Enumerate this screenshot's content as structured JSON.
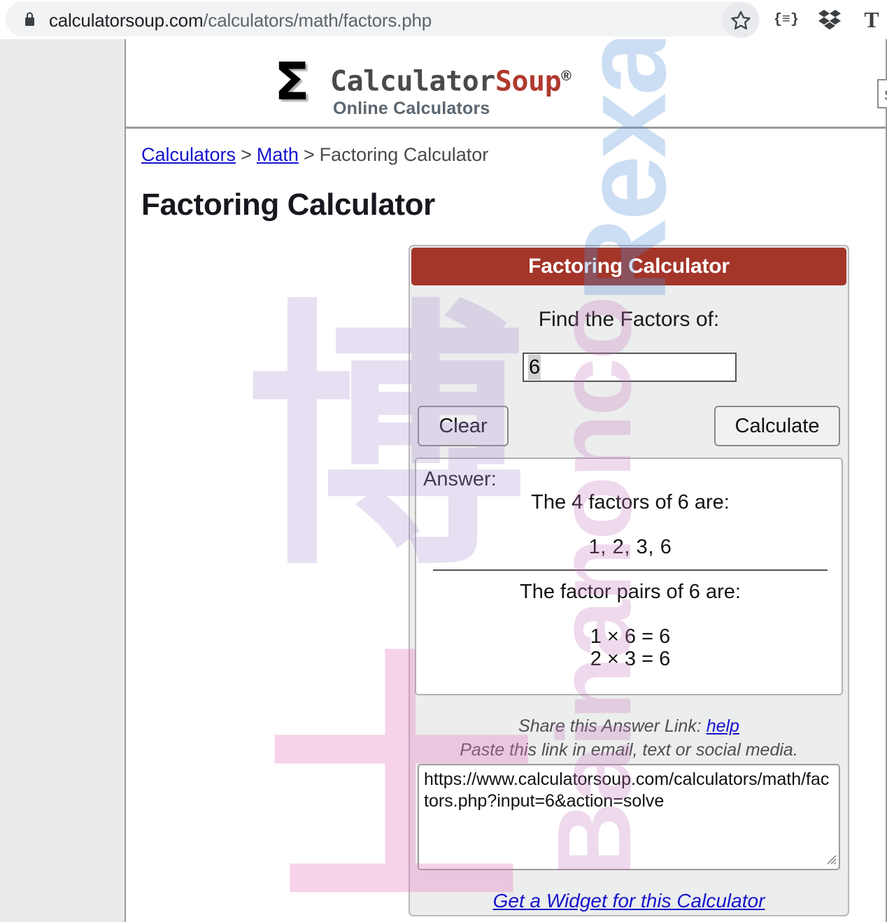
{
  "browser": {
    "url_secure_part": "calculatorsoup.com",
    "url_path_part": "/calculators/math/factors.php",
    "lock_icon": "lock-icon",
    "star_icon": "star-icon",
    "extensions": [
      {
        "name": "json-formatter-icon",
        "glyph": "{≡}"
      },
      {
        "name": "dropbox-icon",
        "glyph": ""
      },
      {
        "name": "text-tool-icon",
        "glyph": "T"
      }
    ]
  },
  "site": {
    "logo_sigma": "Σ",
    "logo_calculator": "Calculator",
    "logo_soup": "Soup",
    "logo_registered": "®",
    "tagline": "Online Calculators",
    "search_placeholder": "search",
    "search_value": ""
  },
  "breadcrumb": {
    "item1": "Calculators",
    "sep1": ">",
    "item2": "Math",
    "sep2": ">",
    "item3": "Factoring Calculator"
  },
  "page": {
    "title": "Factoring Calculator"
  },
  "calculator": {
    "header_title": "Factoring Calculator",
    "prompt": "Find the Factors of:",
    "input_value": "6",
    "clear_label": "Clear",
    "calculate_label": "Calculate",
    "answer_label": "Answer:",
    "factors_heading": "The 4 factors of 6 are:",
    "factors_list": "1, 2, 3, 6",
    "pairs_heading": "The factor pairs of 6 are:",
    "pair_1": "1 × 6 = 6",
    "pair_2": "2 × 3 = 6",
    "share_prefix": "Share this Answer Link:",
    "share_help": "help",
    "share_instruction": "Paste this link in email, text or social media.",
    "share_url": "https://www.calculatorsoup.com/calculators/math/factors.php?input=6&action=solve",
    "widget_link": "Get a Widget for this Calculator"
  },
  "watermarks": {
    "blue_text": "Rexa",
    "pink_text": "Bainanonco",
    "cjk_1": "博",
    "cjk_2": "士"
  },
  "colors": {
    "accent_red": "#a33529",
    "link_blue": "#1414cc",
    "panel_bg": "#eceded",
    "soup_red": "#b03a2e"
  }
}
